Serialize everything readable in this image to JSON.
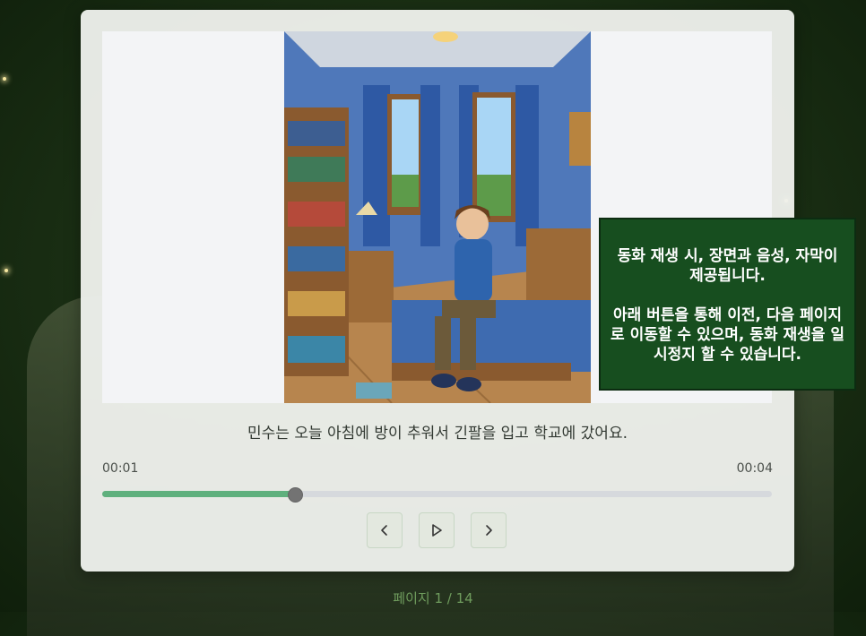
{
  "story": {
    "subtitle": "민수는 오늘 아침에 방이 추워서 긴팔을 입고 학교에 갔어요.",
    "illustration_alt": "아침에 침대에 앉아 있는 소년"
  },
  "player": {
    "current_time": "00:01",
    "total_time": "00:04",
    "progress": 0.286,
    "prev_icon": "chevron-left-icon",
    "play_icon": "play-icon",
    "next_icon": "chevron-right-icon"
  },
  "tooltip": {
    "line1": "동화 재생 시, 장면과 음성, 자막이 제공됩니다.",
    "line2": "아래 버튼을 통해 이전, 다음 페이지로 이동할 수 있으며, 동화 재생을 일시정지 할 수 있습니다."
  },
  "pagination": {
    "label": "페이지 1 / 14"
  },
  "colors": {
    "progress_fill": "#5fb07d",
    "tooltip_bg": "#174e1f"
  }
}
